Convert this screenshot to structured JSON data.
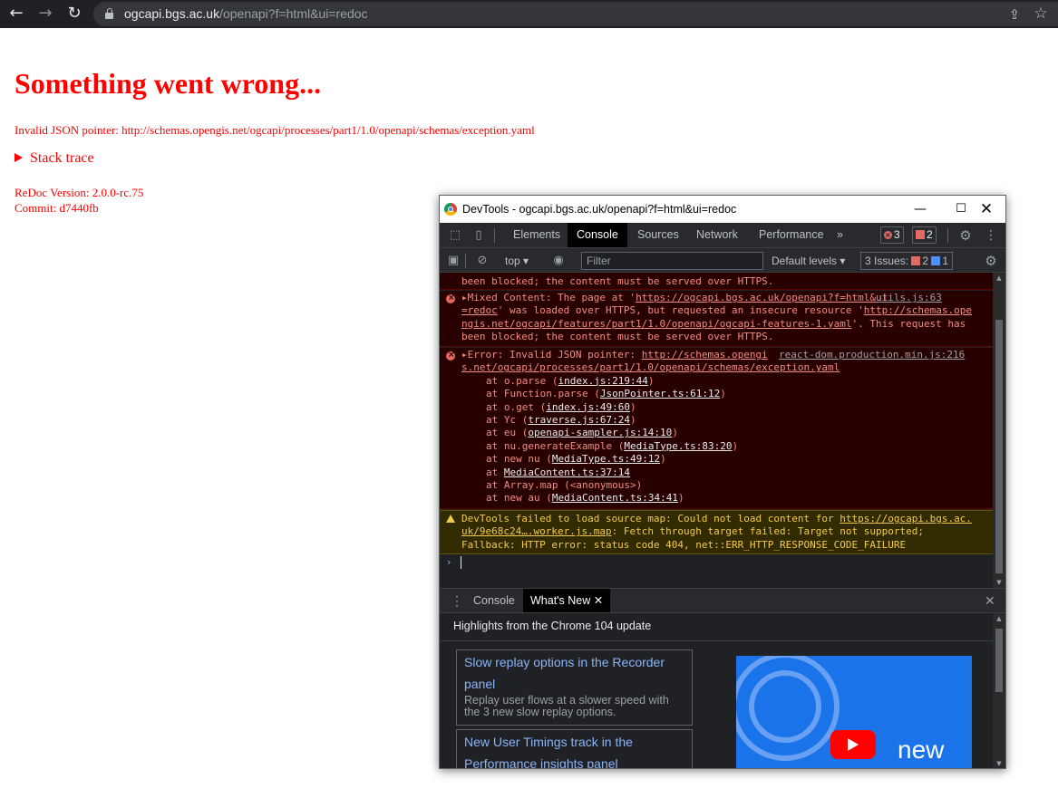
{
  "browser": {
    "url_host": "ogcapi.bgs.ac.uk",
    "url_path": "/openapi?f=html&ui=redoc"
  },
  "page": {
    "title": "Something went wrong...",
    "error_message": "Invalid JSON pointer: http://schemas.opengis.net/ogcapi/processes/part1/1.0/openapi/schemas/exception.yaml",
    "stack_trace_label": "Stack trace",
    "version": "ReDoc Version: 2.0.0-rc.75",
    "commit": "Commit: d7440fb",
    "text_color": "#ff0000"
  },
  "devtools": {
    "window_title": "DevTools - ogcapi.bgs.ac.uk/openapi?f=html&ui=redoc",
    "tabs": [
      "Elements",
      "Console",
      "Sources",
      "Network",
      "Performance"
    ],
    "active_tab": "Console",
    "more_tabs": "»",
    "error_count": "3",
    "issue_count": "2",
    "filter": {
      "context": "top",
      "placeholder": "Filter",
      "levels": "Default levels",
      "issues_label": "3 Issues:",
      "issues_errors": "2",
      "issues_info": "1"
    },
    "console": {
      "partial_top_1": "been blocked; the content must be served over HTTPS.",
      "mixed": {
        "prefix": "Mixed Content: The page at '",
        "link1a": "https://ogcapi.bgs.ac.uk/openapi?f=html&ui",
        "link1b": "=redoc",
        "mid1": "' was loaded over HTTPS, but requested an insecure resource '",
        "link2a": "http://schemas.ope",
        "link2b": "ngis.net/ogcapi/features/part1/1.0/openapi/ogcapi-features-1.yaml",
        "tail1": "'. This request has",
        "tail2": "been blocked; the content must be served over HTTPS.",
        "source": "utils.js:63"
      },
      "error": {
        "prefix": "Error: Invalid JSON pointer: ",
        "link_a": "http://schemas.opengi",
        "link_b": "s.net/ogcapi/processes/part1/1.0/openapi/schemas/exception.yaml",
        "source": "react-dom.production.min.js:216",
        "frames": [
          {
            "fn": "at o.parse (",
            "loc": "index.js:219:44",
            "end": ")"
          },
          {
            "fn": "at Function.parse (",
            "loc": "JsonPointer.ts:61:12",
            "end": ")"
          },
          {
            "fn": "at o.get (",
            "loc": "index.js:49:60",
            "end": ")"
          },
          {
            "fn": "at Yc (",
            "loc": "traverse.js:67:24",
            "end": ")"
          },
          {
            "fn": "at eu (",
            "loc": "openapi-sampler.js:14:10",
            "end": ")"
          },
          {
            "fn": "at nu.generateExample (",
            "loc": "MediaType.ts:83:20",
            "end": ")"
          },
          {
            "fn": "at new nu (",
            "loc": "MediaType.ts:49:12",
            "end": ")"
          },
          {
            "fn": "at ",
            "loc": "MediaContent.ts:37:14",
            "end": ""
          },
          {
            "fn": "at Array.map (<anonymous>)",
            "loc": "",
            "end": ""
          },
          {
            "fn": "at new au (",
            "loc": "MediaContent.ts:34:41",
            "end": ")"
          }
        ]
      },
      "warning": {
        "prefix": "DevTools failed to load source map: Could not load content for ",
        "link_a": "https://ogcapi.bgs.ac.",
        "link_b": "uk/9e68c24….worker.js.map",
        "mid": ": Fetch through target failed: Target not supported;",
        "line3": "Fallback: HTTP error: status code 404, net::ERR_HTTP_RESPONSE_CODE_FAILURE"
      },
      "prompt": "›"
    },
    "drawer": {
      "tabs": [
        "Console",
        "What's New"
      ],
      "active_tab": "What's New",
      "highlights": "Highlights from the Chrome 104 update",
      "cards": [
        {
          "title": "Slow replay options in the Recorder panel",
          "desc": "Replay user flows at a slower speed with the 3 new slow replay options."
        },
        {
          "title": "New User Timings track in the Performance insights panel",
          "desc": ""
        }
      ],
      "video_text": "new"
    }
  }
}
